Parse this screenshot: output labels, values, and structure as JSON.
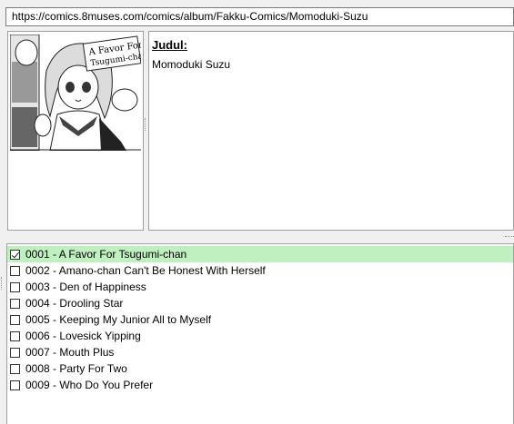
{
  "url_bar": {
    "value": "https://comics.8muses.com/comics/album/Fakku-Comics/Momoduki-Suzu"
  },
  "thumbnail": {
    "icon": "manga-cover-image",
    "cover_title_line1": "A Favor For",
    "cover_title_line2": "Tsugumi-chan"
  },
  "info": {
    "label": "Judul:",
    "value": "Momoduki Suzu"
  },
  "chapters": [
    {
      "label": "0001 - A Favor For Tsugumi-chan",
      "checked": true,
      "selected": true
    },
    {
      "label": "0002 - Amano-chan Can't Be Honest With Herself",
      "checked": false
    },
    {
      "label": "0003 - Den of Happiness",
      "checked": false
    },
    {
      "label": "0004 - Drooling Star",
      "checked": false
    },
    {
      "label": "0005 - Keeping My Junior All to Myself",
      "checked": false
    },
    {
      "label": "0006 - Lovesick Yipping",
      "checked": false
    },
    {
      "label": "0007 - Mouth Plus",
      "checked": false
    },
    {
      "label": "0008 - Party For Two",
      "checked": false
    },
    {
      "label": "0009 - Who Do You Prefer",
      "checked": false
    }
  ],
  "colors": {
    "selected_row": "#bff0bf",
    "panel_border": "#a0a0a0"
  }
}
